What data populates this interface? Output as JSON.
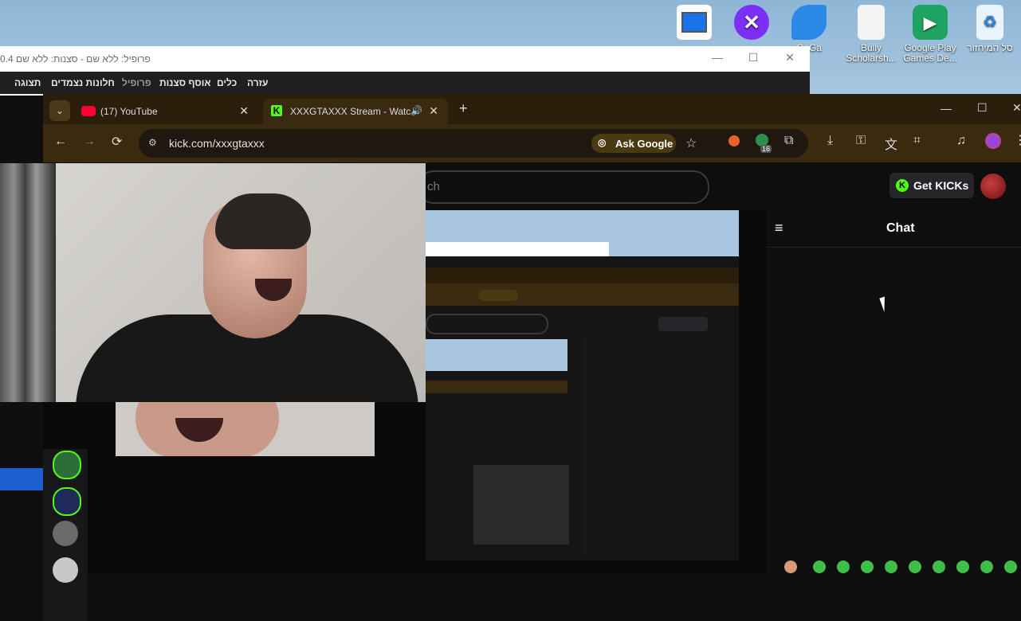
{
  "desktop": {
    "icons": [
      {
        "label": "",
        "icon": "window-icon"
      },
      {
        "label": "",
        "icon": "x-app-icon"
      },
      {
        "label": "GaGa",
        "icon": "bird-app-icon"
      },
      {
        "label": "Bully Scholarsh...",
        "icon": "document-icon"
      },
      {
        "label": "Google Play Games De...",
        "icon": "play-games-icon"
      },
      {
        "label": "סל המיחזור",
        "icon": "recycle-bin-icon"
      }
    ]
  },
  "obs": {
    "title": "פרופיל: ללא שם - סצנות: ללא שם",
    "title_prefix": "0.4",
    "menu": [
      "עזרה",
      "כלים",
      "אוסף סצנות",
      "פרופיל",
      "חלונות נצמדים",
      "תצוגה"
    ]
  },
  "browser": {
    "tabs": [
      {
        "title": "(17) YouTube",
        "icon": "youtube-icon"
      },
      {
        "title": "XXXGTAXXX Stream - Watc",
        "icon": "kick-icon"
      }
    ],
    "url": "kick.com/xxxgtaxxx",
    "ask_google": "Ask Google",
    "extension_badge": "16"
  },
  "page": {
    "search_placeholder": "ch",
    "get_kicks": "Get KICKs",
    "chat_title": "Chat"
  },
  "colors": {
    "kick_green": "#53fc18",
    "browser_theme": "#3a2a10"
  }
}
